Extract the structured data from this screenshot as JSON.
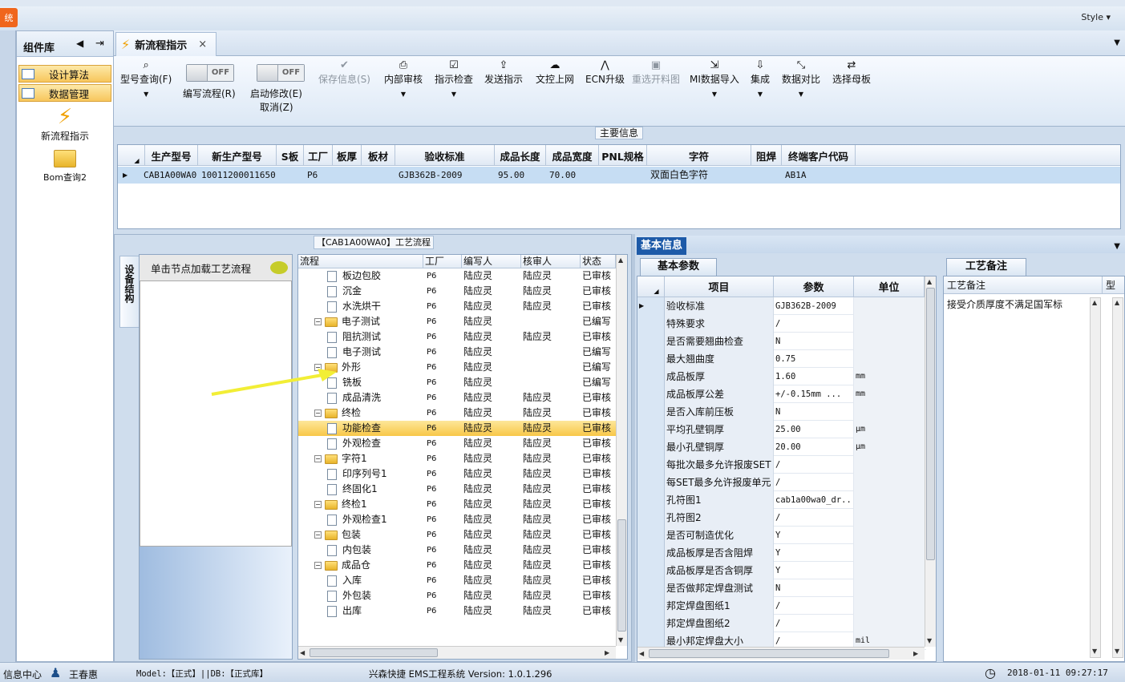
{
  "titlebar": {
    "style_menu": "Style ▾",
    "left_button": "统"
  },
  "component_panel": {
    "title": "组件库",
    "nav_buttons": [
      "设计算法",
      "数据管理"
    ],
    "items": [
      "新流程指示",
      "Bom查询2"
    ]
  },
  "tab": {
    "label": "新流程指示",
    "close": "×"
  },
  "ribbon": {
    "buttons": [
      {
        "label": "型号查询(F)",
        "icon": "search-icon"
      },
      {
        "label": "编写流程(R)",
        "toggle": "OFF"
      },
      {
        "label": "启动修改(E)",
        "label2": "取消(Z)",
        "toggle": "OFF"
      },
      {
        "label": "保存信息(S)",
        "icon": "check-icon",
        "disabled": true
      },
      {
        "label": "内部审核",
        "icon": "printer-icon"
      },
      {
        "label": "指示检查",
        "icon": "checkbox-icon"
      },
      {
        "label": "发送指示",
        "icon": "upload-icon"
      },
      {
        "label": "文控上网",
        "icon": "cloud-upload-icon"
      },
      {
        "label": "ECN升级",
        "icon": "ecn-icon"
      },
      {
        "label": "重选开料图",
        "icon": "image-icon",
        "disabled": true
      },
      {
        "label": "MI数据导入",
        "icon": "import-icon"
      },
      {
        "label": "集成",
        "icon": "download-icon"
      },
      {
        "label": "数据对比",
        "icon": "compare-icon"
      },
      {
        "label": "选择母板",
        "icon": "shuffle-icon"
      }
    ]
  },
  "main_info": {
    "label": "主要信息",
    "columns": [
      "生产型号",
      "新生产型号",
      "S板",
      "工厂",
      "板厚",
      "板材",
      "验收标准",
      "成品长度",
      "成品宽度",
      "PNL规格",
      "字符",
      "阻焊",
      "终端客户代码"
    ],
    "rows": [
      [
        "CAB1A00WA0",
        "10011200011650",
        "",
        "P6",
        "",
        "",
        "GJB362B-2009",
        "95.00",
        "70.00",
        "",
        "双面白色字符",
        "",
        "AB1A"
      ]
    ]
  },
  "flow_panel": {
    "label": "【CAB1A00WA0】工艺流程",
    "side_tab": "设备结构",
    "hint": "单击节点加载工艺流程",
    "columns": [
      "流程",
      "工厂",
      "编写人",
      "核审人",
      "状态"
    ],
    "rows": [
      {
        "level": 1,
        "name": "板边包胶",
        "plant": "P6",
        "writer": "陆应灵",
        "reviewer": "陆应灵",
        "status": "已审核"
      },
      {
        "level": 1,
        "name": "沉金",
        "plant": "P6",
        "writer": "陆应灵",
        "reviewer": "陆应灵",
        "status": "已审核"
      },
      {
        "level": 1,
        "name": "水洗烘干",
        "plant": "P6",
        "writer": "陆应灵",
        "reviewer": "陆应灵",
        "status": "已审核"
      },
      {
        "level": 0,
        "name": "电子测试",
        "plant": "P6",
        "writer": "陆应灵",
        "reviewer": "",
        "status": "已编写"
      },
      {
        "level": 1,
        "name": "阻抗测试",
        "plant": "P6",
        "writer": "陆应灵",
        "reviewer": "陆应灵",
        "status": "已审核"
      },
      {
        "level": 1,
        "name": "电子测试",
        "plant": "P6",
        "writer": "陆应灵",
        "reviewer": "",
        "status": "已编写"
      },
      {
        "level": 0,
        "name": "外形",
        "plant": "P6",
        "writer": "陆应灵",
        "reviewer": "",
        "status": "已编写"
      },
      {
        "level": 1,
        "name": "铣板",
        "plant": "P6",
        "writer": "陆应灵",
        "reviewer": "",
        "status": "已编写"
      },
      {
        "level": 1,
        "name": "成品清洗",
        "plant": "P6",
        "writer": "陆应灵",
        "reviewer": "陆应灵",
        "status": "已审核"
      },
      {
        "level": 0,
        "name": "终检",
        "plant": "P6",
        "writer": "陆应灵",
        "reviewer": "陆应灵",
        "status": "已审核"
      },
      {
        "level": 1,
        "name": "功能检查",
        "plant": "P6",
        "writer": "陆应灵",
        "reviewer": "陆应灵",
        "status": "已审核",
        "selected": true
      },
      {
        "level": 1,
        "name": "外观检查",
        "plant": "P6",
        "writer": "陆应灵",
        "reviewer": "陆应灵",
        "status": "已审核"
      },
      {
        "level": 0,
        "name": "字符1",
        "plant": "P6",
        "writer": "陆应灵",
        "reviewer": "陆应灵",
        "status": "已审核"
      },
      {
        "level": 1,
        "name": "印序列号1",
        "plant": "P6",
        "writer": "陆应灵",
        "reviewer": "陆应灵",
        "status": "已审核"
      },
      {
        "level": 1,
        "name": "终固化1",
        "plant": "P6",
        "writer": "陆应灵",
        "reviewer": "陆应灵",
        "status": "已审核"
      },
      {
        "level": 0,
        "name": "终检1",
        "plant": "P6",
        "writer": "陆应灵",
        "reviewer": "陆应灵",
        "status": "已审核"
      },
      {
        "level": 1,
        "name": "外观检查1",
        "plant": "P6",
        "writer": "陆应灵",
        "reviewer": "陆应灵",
        "status": "已审核"
      },
      {
        "level": 0,
        "name": "包装",
        "plant": "P6",
        "writer": "陆应灵",
        "reviewer": "陆应灵",
        "status": "已审核"
      },
      {
        "level": 1,
        "name": "内包装",
        "plant": "P6",
        "writer": "陆应灵",
        "reviewer": "陆应灵",
        "status": "已审核"
      },
      {
        "level": 0,
        "name": "成品仓",
        "plant": "P6",
        "writer": "陆应灵",
        "reviewer": "陆应灵",
        "status": "已审核"
      },
      {
        "level": 1,
        "name": "入库",
        "plant": "P6",
        "writer": "陆应灵",
        "reviewer": "陆应灵",
        "status": "已审核"
      },
      {
        "level": 1,
        "name": "外包装",
        "plant": "P6",
        "writer": "陆应灵",
        "reviewer": "陆应灵",
        "status": "已审核"
      },
      {
        "level": 1,
        "name": "出库",
        "plant": "P6",
        "writer": "陆应灵",
        "reviewer": "陆应灵",
        "status": "已审核"
      }
    ]
  },
  "basic_info": {
    "tab": "基本信息",
    "params_tab": "基本参数",
    "columns": [
      "项目",
      "参数",
      "单位"
    ],
    "rows": [
      [
        "验收标准",
        "GJB362B-2009",
        ""
      ],
      [
        "特殊要求",
        "/",
        ""
      ],
      [
        "是否需要翘曲检查",
        "N",
        ""
      ],
      [
        "最大翘曲度",
        "0.75",
        ""
      ],
      [
        "成品板厚",
        "1.60",
        "mm"
      ],
      [
        "成品板厚公差",
        "+/-0.15mm   ...",
        "mm"
      ],
      [
        "是否入库前压板",
        "N",
        ""
      ],
      [
        "平均孔壁铜厚",
        "25.00",
        "μm"
      ],
      [
        "最小孔壁铜厚",
        "20.00",
        "μm"
      ],
      [
        "每批次最多允许报废SET",
        "/",
        ""
      ],
      [
        "每SET最多允许报废单元",
        "/",
        ""
      ],
      [
        "孔符图1",
        "cab1a00wa0_dr...",
        ""
      ],
      [
        "孔符图2",
        "/",
        ""
      ],
      [
        "是否可制造优化",
        "Y",
        ""
      ],
      [
        "成品板厚是否含阻焊",
        "Y",
        ""
      ],
      [
        "成品板厚是否含铜厚",
        "Y",
        ""
      ],
      [
        "是否做邦定焊盘测试",
        "N",
        ""
      ],
      [
        "邦定焊盘图纸1",
        "/",
        ""
      ],
      [
        "邦定焊盘图纸2",
        "/",
        ""
      ],
      [
        "最小邦定焊盘大小",
        "/",
        "mil"
      ]
    ],
    "remarks_tab": "工艺备注",
    "remarks_col": "工艺备注",
    "remarks_col2": "型",
    "remark_text": "接受介质厚度不满足国军标"
  },
  "status": {
    "info_center": "信息中心",
    "user": "王春惠",
    "model": "Model:【正式】||DB:【正式库】",
    "system": "兴森快捷 EMS工程系统 Version: 1.0.1.296",
    "datetime": "2018-01-11 09:27:17"
  }
}
